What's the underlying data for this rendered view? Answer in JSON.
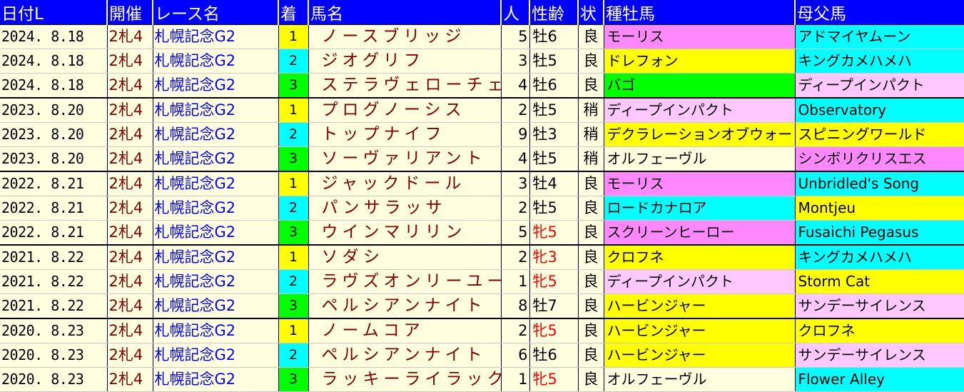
{
  "headers": [
    "日付L",
    "開催",
    "レース名",
    "着",
    "馬名",
    "人",
    "性齢",
    "状",
    "種牡馬",
    "母父馬"
  ],
  "colors": {
    "header_bg": "#0000ff",
    "rank_1": "#ffff00",
    "rank_2": "#00ffff",
    "rank_3": "#00ff00",
    "pink": "#ff88ff",
    "cyan": "#00ffff",
    "yellow": "#ffff00",
    "green": "#00ff00",
    "light_pink": "#ffc8ff",
    "cream": "#ffffe0"
  },
  "rows": [
    {
      "date": "2024. 8.18",
      "kaisai": "2札4",
      "race": "札幌記念G2",
      "rank": "1",
      "horse": "ノースブリッジ",
      "pop": "5",
      "sex": "牡6",
      "track": "良",
      "sire": "モーリス",
      "sire_color": "pink",
      "damsire": "アドマイヤムーン",
      "damsire_color": "cyan"
    },
    {
      "date": "2024. 8.18",
      "kaisai": "2札4",
      "race": "札幌記念G2",
      "rank": "2",
      "horse": "ジオグリフ",
      "pop": "3",
      "sex": "牡5",
      "track": "良",
      "sire": "ドレフォン",
      "sire_color": "yellow",
      "damsire": "キングカメハメハ",
      "damsire_color": "cyan"
    },
    {
      "date": "2024. 8.18",
      "kaisai": "2札4",
      "race": "札幌記念G2",
      "rank": "3",
      "horse": "ステラヴェローチェ",
      "pop": "4",
      "sex": "牡6",
      "track": "良",
      "sire": "バゴ",
      "sire_color": "green",
      "damsire": "ディープインパクト",
      "damsire_color": "light_pink"
    },
    {
      "date": "2023. 8.20",
      "kaisai": "2札4",
      "race": "札幌記念G2",
      "rank": "1",
      "horse": "プログノーシス",
      "pop": "2",
      "sex": "牡5",
      "track": "稍",
      "sire": "ディープインパクト",
      "sire_color": "light_pink",
      "damsire": "Observatory",
      "damsire_color": "cyan"
    },
    {
      "date": "2023. 8.20",
      "kaisai": "2札4",
      "race": "札幌記念G2",
      "rank": "2",
      "horse": "トップナイフ",
      "pop": "9",
      "sex": "牡3",
      "track": "稍",
      "sire": "デクラレーションオブウォー",
      "sire_color": "yellow",
      "damsire": "スピニングワールド",
      "damsire_color": "yellow"
    },
    {
      "date": "2023. 8.20",
      "kaisai": "2札4",
      "race": "札幌記念G2",
      "rank": "3",
      "horse": "ソーヴァリアント",
      "pop": "4",
      "sex": "牡5",
      "track": "稍",
      "sire": "オルフェーヴル",
      "sire_color": "cream",
      "damsire": "シンボリクリスエス",
      "damsire_color": "pink"
    },
    {
      "date": "2022. 8.21",
      "kaisai": "2札4",
      "race": "札幌記念G2",
      "rank": "1",
      "horse": "ジャックドール",
      "pop": "3",
      "sex": "牡4",
      "track": "良",
      "sire": "モーリス",
      "sire_color": "pink",
      "damsire": "Unbridled's Song",
      "damsire_color": "cyan"
    },
    {
      "date": "2022. 8.21",
      "kaisai": "2札4",
      "race": "札幌記念G2",
      "rank": "2",
      "horse": "パンサラッサ",
      "pop": "2",
      "sex": "牡5",
      "track": "良",
      "sire": "ロードカナロア",
      "sire_color": "cyan",
      "damsire": "Montjeu",
      "damsire_color": "yellow"
    },
    {
      "date": "2022. 8.21",
      "kaisai": "2札4",
      "race": "札幌記念G2",
      "rank": "3",
      "horse": "ウインマリリン",
      "pop": "5",
      "sex": "牝5",
      "track": "良",
      "sire": "スクリーンヒーロー",
      "sire_color": "pink",
      "damsire": "Fusaichi Pegasus",
      "damsire_color": "cyan"
    },
    {
      "date": "2021. 8.22",
      "kaisai": "2札4",
      "race": "札幌記念G2",
      "rank": "1",
      "horse": "ソダシ",
      "pop": "2",
      "sex": "牝3",
      "track": "良",
      "sire": "クロフネ",
      "sire_color": "yellow",
      "damsire": "キングカメハメハ",
      "damsire_color": "cyan"
    },
    {
      "date": "2021. 8.22",
      "kaisai": "2札4",
      "race": "札幌記念G2",
      "rank": "2",
      "horse": "ラヴズオンリーユー",
      "pop": "1",
      "sex": "牝5",
      "track": "良",
      "sire": "ディープインパクト",
      "sire_color": "light_pink",
      "damsire": "Storm Cat",
      "damsire_color": "yellow"
    },
    {
      "date": "2021. 8.22",
      "kaisai": "2札4",
      "race": "札幌記念G2",
      "rank": "3",
      "horse": "ペルシアンナイト",
      "pop": "8",
      "sex": "牡7",
      "track": "良",
      "sire": "ハービンジャー",
      "sire_color": "yellow",
      "damsire": "サンデーサイレンス",
      "damsire_color": "light_pink"
    },
    {
      "date": "2020. 8.23",
      "kaisai": "2札4",
      "race": "札幌記念G2",
      "rank": "1",
      "horse": "ノームコア",
      "pop": "2",
      "sex": "牝5",
      "track": "良",
      "sire": "ハービンジャー",
      "sire_color": "yellow",
      "damsire": "クロフネ",
      "damsire_color": "yellow"
    },
    {
      "date": "2020. 8.23",
      "kaisai": "2札4",
      "race": "札幌記念G2",
      "rank": "2",
      "horse": "ペルシアンナイト",
      "pop": "6",
      "sex": "牡6",
      "track": "良",
      "sire": "ハービンジャー",
      "sire_color": "yellow",
      "damsire": "サンデーサイレンス",
      "damsire_color": "light_pink"
    },
    {
      "date": "2020. 8.23",
      "kaisai": "2札4",
      "race": "札幌記念G2",
      "rank": "3",
      "horse": "ラッキーライラック",
      "pop": "1",
      "sex": "牝5",
      "track": "良",
      "sire": "オルフェーヴル",
      "sire_color": "cream",
      "damsire": "Flower Alley",
      "damsire_color": "cyan"
    }
  ]
}
